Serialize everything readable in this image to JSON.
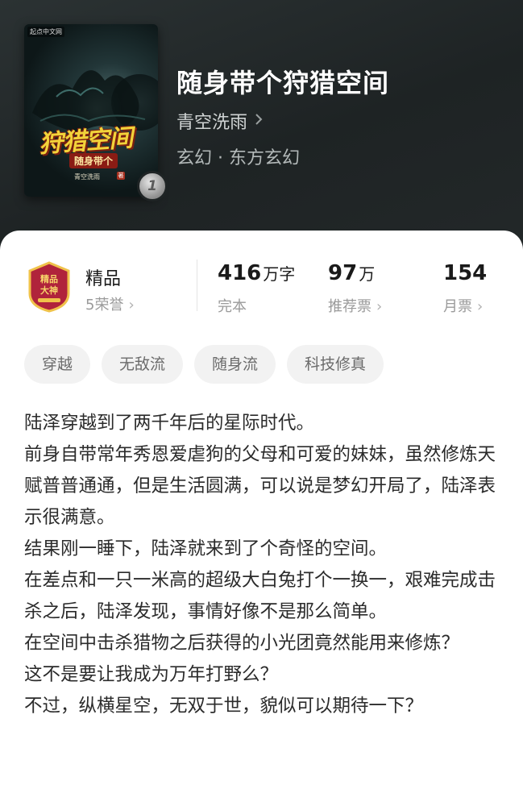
{
  "book": {
    "title": "随身带个狩猎空间",
    "author": "青空洗雨",
    "genre": "玄幻 · 东方玄幻",
    "rank_badge": "1"
  },
  "cover": {
    "publisher": "起点中文网",
    "title_art": "狩猎空间",
    "subtitle": "随身带个",
    "author": "青空洗雨"
  },
  "quality": {
    "label": "精品",
    "honors": "5荣誉",
    "seal_text": "精品 大神 频道"
  },
  "stats": [
    {
      "value": "416",
      "unit": "万字",
      "label": "完本",
      "has_link": false
    },
    {
      "value": "97",
      "unit": "万",
      "label": "推荐票",
      "has_link": true
    },
    {
      "value": "154",
      "unit": "",
      "label": "月票",
      "has_link": true
    }
  ],
  "tags": [
    "穿越",
    "无敌流",
    "随身流",
    "科技修真"
  ],
  "synopsis": [
    "陆泽穿越到了两千年后的星际时代。",
    "前身自带常年秀恩爱虐狗的父母和可爱的妹妹，虽然修炼天赋普普通通，但是生活圆满，可以说是梦幻开局了，陆泽表示很满意。",
    "结果刚一睡下，陆泽就来到了个奇怪的空间。",
    "在差点和一只一米高的超级大白兔打个一换一，艰难完成击杀之后，陆泽发现，事情好像不是那么简单。",
    "在空间中击杀猎物之后获得的小光团竟然能用来修炼？",
    "这不是要让我成为万年打野么？",
    "不过，纵横星空，无双于世，貌似可以期待一下？"
  ],
  "colors": {
    "header_bg": "#232829",
    "card_bg": "#ffffff",
    "tag_bg": "#f2f2f2",
    "seal_red": "#b0233b",
    "seal_gold": "#f0c24a"
  },
  "icons": {
    "chevron": "chevron-right-icon"
  }
}
